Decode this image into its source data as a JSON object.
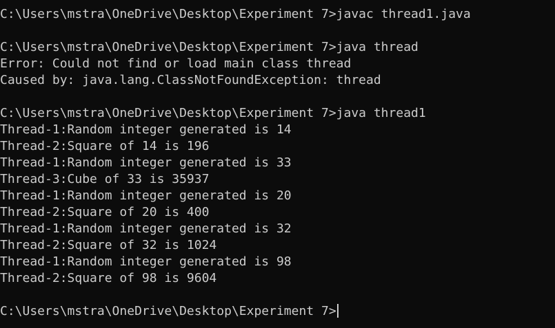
{
  "window": {
    "type": "command-prompt"
  },
  "theme": {
    "background": "#0c0c0c",
    "foreground": "#cccccc"
  },
  "lines": [
    "C:\\Users\\mstra\\OneDrive\\Desktop\\Experiment 7>javac thread1.java",
    "",
    "C:\\Users\\mstra\\OneDrive\\Desktop\\Experiment 7>java thread",
    "Error: Could not find or load main class thread",
    "Caused by: java.lang.ClassNotFoundException: thread",
    "",
    "C:\\Users\\mstra\\OneDrive\\Desktop\\Experiment 7>java thread1",
    "Thread-1:Random integer generated is 14",
    "Thread-2:Square of 14 is 196",
    "Thread-1:Random integer generated is 33",
    "Thread-3:Cube of 33 is 35937",
    "Thread-1:Random integer generated is 20",
    "Thread-2:Square of 20 is 400",
    "Thread-1:Random integer generated is 32",
    "Thread-2:Square of 32 is 1024",
    "Thread-1:Random integer generated is 98",
    "Thread-2:Square of 98 is 9604",
    ""
  ],
  "prompt": "C:\\Users\\mstra\\OneDrive\\Desktop\\Experiment 7>"
}
